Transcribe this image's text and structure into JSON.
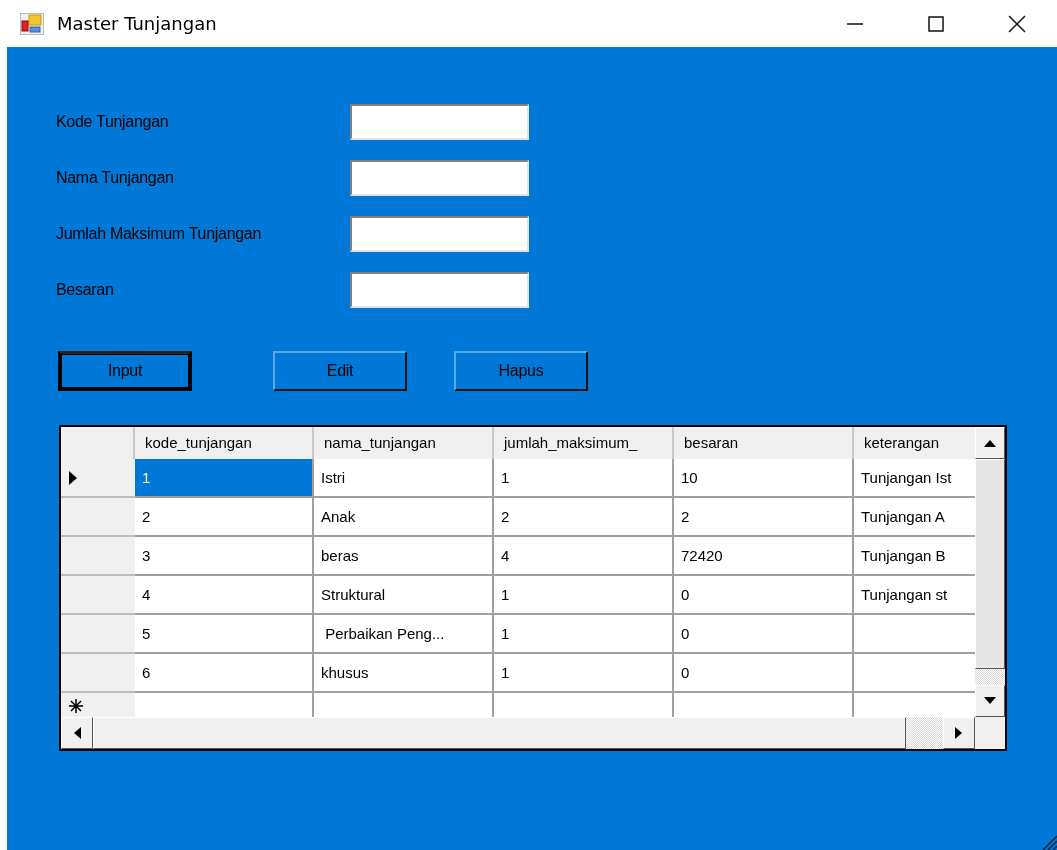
{
  "window": {
    "title": "Master  Tunjangan"
  },
  "form": {
    "fields": [
      {
        "label": "Kode Tunjangan"
      },
      {
        "label": "Nama Tunjangan"
      },
      {
        "label": "Jumlah Maksimum Tunjangan"
      },
      {
        "label": "Besaran"
      }
    ],
    "buttons": [
      {
        "label": "Input",
        "focused": true
      },
      {
        "label": "Edit",
        "focused": false
      },
      {
        "label": "Hapus",
        "focused": false
      }
    ]
  },
  "table": {
    "columns": [
      "kode_tunjangan",
      "nama_tunjangan",
      "jumlah_maksimum_",
      "besaran",
      "keterangan"
    ],
    "rows": [
      {
        "kind": "data",
        "current": true,
        "cells": [
          {
            "text": "1",
            "selected": true
          },
          {
            "text": "Istri",
            "selected": false
          },
          {
            "text": "1",
            "selected": false
          },
          {
            "text": "10",
            "selected": false
          },
          {
            "text": "Tunjangan Ist",
            "selected": false
          }
        ]
      },
      {
        "kind": "data",
        "current": false,
        "cells": [
          {
            "text": "2",
            "selected": false
          },
          {
            "text": "Anak",
            "selected": false
          },
          {
            "text": "2",
            "selected": false
          },
          {
            "text": "2",
            "selected": false
          },
          {
            "text": "Tunjangan A",
            "selected": false
          }
        ]
      },
      {
        "kind": "data",
        "current": false,
        "cells": [
          {
            "text": "3",
            "selected": false
          },
          {
            "text": "beras",
            "selected": false
          },
          {
            "text": "4",
            "selected": false
          },
          {
            "text": "72420",
            "selected": false
          },
          {
            "text": "Tunjangan B",
            "selected": false
          }
        ]
      },
      {
        "kind": "data",
        "current": false,
        "cells": [
          {
            "text": "4",
            "selected": false
          },
          {
            "text": "Struktural",
            "selected": false
          },
          {
            "text": "1",
            "selected": false
          },
          {
            "text": "0",
            "selected": false
          },
          {
            "text": "Tunjangan st",
            "selected": false
          }
        ]
      },
      {
        "kind": "data",
        "current": false,
        "cells": [
          {
            "text": "5",
            "selected": false
          },
          {
            "text": " Perbaikan Peng...",
            "selected": false
          },
          {
            "text": "1",
            "selected": false
          },
          {
            "text": "0",
            "selected": false
          },
          {
            "selected": false
          }
        ]
      },
      {
        "kind": "data",
        "current": false,
        "cells": [
          {
            "text": "6",
            "selected": false
          },
          {
            "text": "khusus",
            "selected": false
          },
          {
            "text": "1",
            "selected": false
          },
          {
            "text": "0",
            "selected": false
          },
          {
            "selected": false
          }
        ]
      },
      {
        "kind": "new",
        "current": false,
        "cells": [
          {
            "selected": false
          },
          {
            "selected": false
          },
          {
            "selected": false
          },
          {
            "selected": false
          },
          {
            "selected": false
          }
        ]
      }
    ]
  }
}
